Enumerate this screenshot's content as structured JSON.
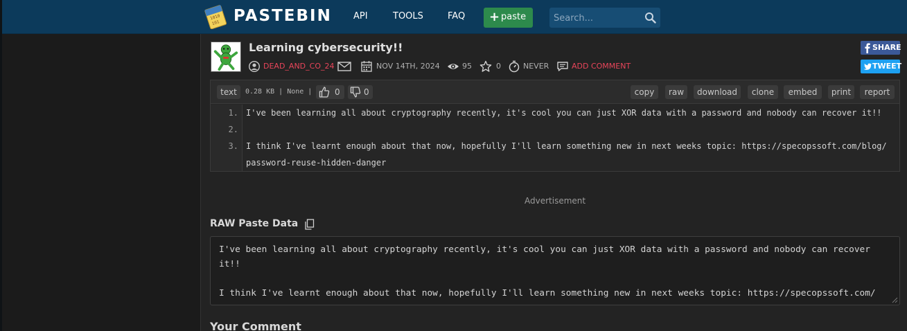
{
  "header": {
    "brand": "PASTEBIN",
    "nav": [
      "API",
      "TOOLS",
      "FAQ"
    ],
    "paste_button": "paste",
    "search_placeholder": "Search..."
  },
  "paste": {
    "title": "Learning cybersecurity!!",
    "author": "DEAD_AND_CO_24",
    "date": "NOV 14TH, 2024",
    "views": "95",
    "stars": "0",
    "expires": "NEVER",
    "add_comment": "ADD COMMENT"
  },
  "share": {
    "share": "SHARE",
    "tweet": "TWEET"
  },
  "code": {
    "syntax": "text",
    "size_info": "0.28 KB | None |",
    "likes": "0",
    "dislikes": "0",
    "actions": [
      "copy",
      "raw",
      "download",
      "clone",
      "embed",
      "print",
      "report"
    ],
    "line_numbers": [
      "1.",
      "2.",
      "3."
    ],
    "lines": [
      "I've been learning all about cryptography recently, it's cool you can just XOR data with a password and nobody can recover it!!",
      "",
      "I think I've learnt enough about that now, hopefully I'll learn something new in next weeks topic: https://specopssoft.com/blog/",
      "password-reuse-hidden-danger"
    ]
  },
  "advertisement": "Advertisement",
  "raw": {
    "title": "RAW Paste Data",
    "lines": [
      "I've been learning all about cryptography recently, it's cool you can just XOR data with a password and nobody can recover",
      "it!!",
      "",
      "I think I've learnt enough about that now, hopefully I'll learn something new in next weeks topic: https://specopssoft.com/"
    ]
  },
  "comment_title": "Your Comment",
  "colors": {
    "header_bg": "#0c3a5b",
    "paste_green": "#2d8a4c",
    "author_red": "#e8455a",
    "share_blue": "#3b5998",
    "tweet_blue": "#1da1f2"
  }
}
